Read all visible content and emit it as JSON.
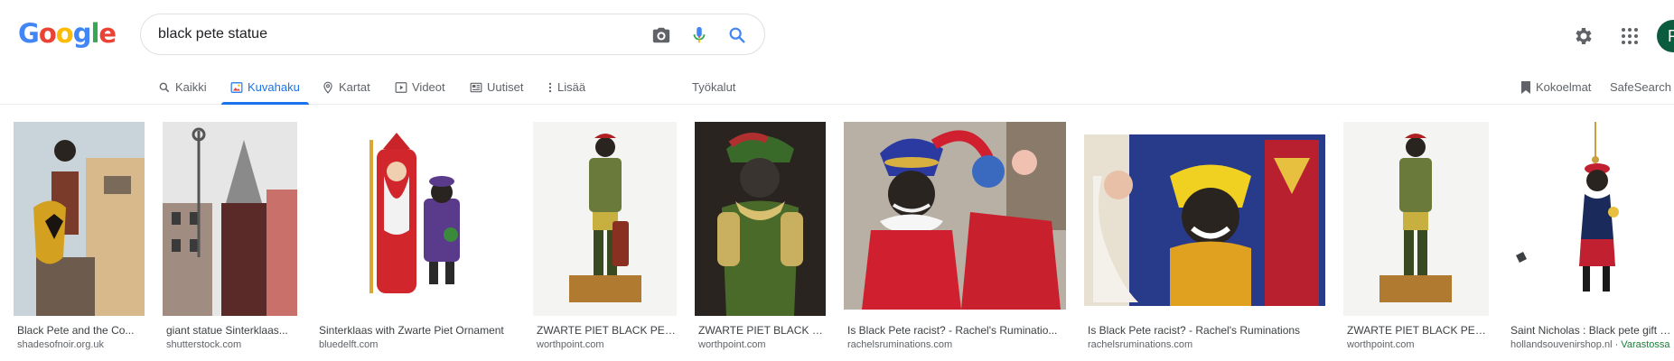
{
  "logo": {
    "text": "Google"
  },
  "search": {
    "query": "black pete statue"
  },
  "header": {
    "avatar_letter": "P"
  },
  "tabs": [
    {
      "label": "Kaikki",
      "icon": "search-icon"
    },
    {
      "label": "Kuvahaku",
      "icon": "image-icon",
      "active": true
    },
    {
      "label": "Kartat",
      "icon": "map-pin-icon"
    },
    {
      "label": "Videot",
      "icon": "video-icon"
    },
    {
      "label": "Uutiset",
      "icon": "news-icon"
    },
    {
      "label": "Lisää",
      "icon": "more-vert-icon"
    }
  ],
  "tools_label": "Työkalut",
  "collections_label": "Kokoelmat",
  "safesearch_label": "SafeSearch",
  "results": [
    {
      "title": "Black Pete and the Co...",
      "source": "shadesofnoir.org.uk"
    },
    {
      "title": "giant statue Sinterklaas...",
      "source": "shutterstock.com"
    },
    {
      "title": "Sinterklaas with Zwarte Piet Ornament",
      "source": "bluedelft.com"
    },
    {
      "title": "ZWARTE PIET BLACK PET...",
      "source": "worthpoint.com"
    },
    {
      "title": "ZWARTE PIET BLACK P...",
      "source": "worthpoint.com"
    },
    {
      "title": "Is Black Pete racist? - Rachel's Ruminatio...",
      "source": "rachelsruminations.com"
    },
    {
      "title": "Is Black Pete racist? - Rachel's Ruminations",
      "source": "rachelsruminations.com"
    },
    {
      "title": "ZWARTE PIET BLACK PET...",
      "source": "worthpoint.com"
    },
    {
      "title": "Saint Nicholas : Black pete gift ba...",
      "source": "hollandsouvenirshop.nl",
      "stock": " · Varastossa"
    }
  ]
}
